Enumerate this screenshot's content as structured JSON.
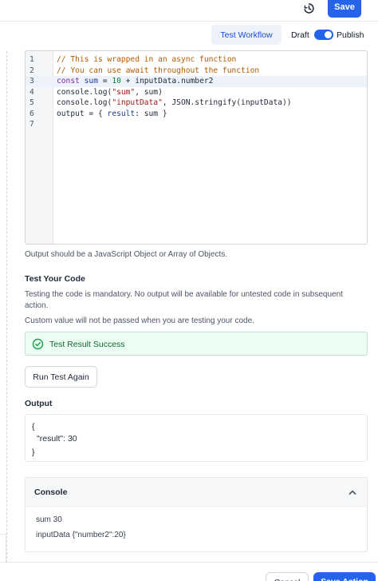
{
  "header": {
    "history_icon": "history-clock-icon",
    "save_label": "Save"
  },
  "subbar": {
    "test_workflow_label": "Test Workflow",
    "draft_label": "Draft",
    "publish_label": "Publish",
    "publish_toggle_on": true
  },
  "editor": {
    "lines": [
      {
        "num": "1",
        "segments": [
          {
            "t": "// This is wrapped in an async function",
            "c": "comment"
          }
        ]
      },
      {
        "num": "2",
        "segments": [
          {
            "t": "// You can use await throughout the function",
            "c": "comment"
          }
        ]
      },
      {
        "num": "3",
        "segments": [
          {
            "t": "const ",
            "c": "kw"
          },
          {
            "t": "sum",
            "c": "var"
          },
          {
            "t": " = ",
            "c": ""
          },
          {
            "t": "10",
            "c": "num"
          },
          {
            "t": " + inputData.number2",
            "c": ""
          }
        ],
        "active": true
      },
      {
        "num": "4",
        "segments": [
          {
            "t": "console.log(",
            "c": ""
          },
          {
            "t": "\"sum\"",
            "c": "str"
          },
          {
            "t": ", sum)",
            "c": ""
          }
        ]
      },
      {
        "num": "5",
        "segments": [
          {
            "t": "console.log(",
            "c": ""
          },
          {
            "t": "\"inputData\"",
            "c": "str"
          },
          {
            "t": ", JSON.stringify(inputData))",
            "c": ""
          }
        ]
      },
      {
        "num": "6",
        "segments": [
          {
            "t": "output = { ",
            "c": ""
          },
          {
            "t": "result",
            "c": "var"
          },
          {
            "t": ": sum }",
            "c": ""
          }
        ]
      },
      {
        "num": "7",
        "segments": [
          {
            "t": "",
            "c": ""
          }
        ]
      }
    ],
    "hint": "Output should be a JavaScript Object or Array of Objects."
  },
  "test": {
    "title": "Test Your Code",
    "mandatory_text": "Testing the code is mandatory. No output will be available for untested code in subsequent action.",
    "custom_value_text": "Custom value will not be passed when you are testing your code.",
    "success_text": "Test Result Success",
    "success_icon": "check-circle-icon",
    "run_again_label": "Run Test Again"
  },
  "output": {
    "title": "Output",
    "lines": [
      "{",
      "\"result\": 30",
      "}"
    ]
  },
  "console": {
    "title": "Console",
    "chevron_icon": "chevron-up-icon",
    "lines": [
      "sum 30",
      "inputData {\"number2\":20}"
    ]
  },
  "footer": {
    "cancel_label": "Cancel",
    "save_action_label": "Save Action"
  },
  "colors": {
    "accent": "#2563eb",
    "success_bg": "#ecfdf3",
    "success_text": "#166534"
  }
}
